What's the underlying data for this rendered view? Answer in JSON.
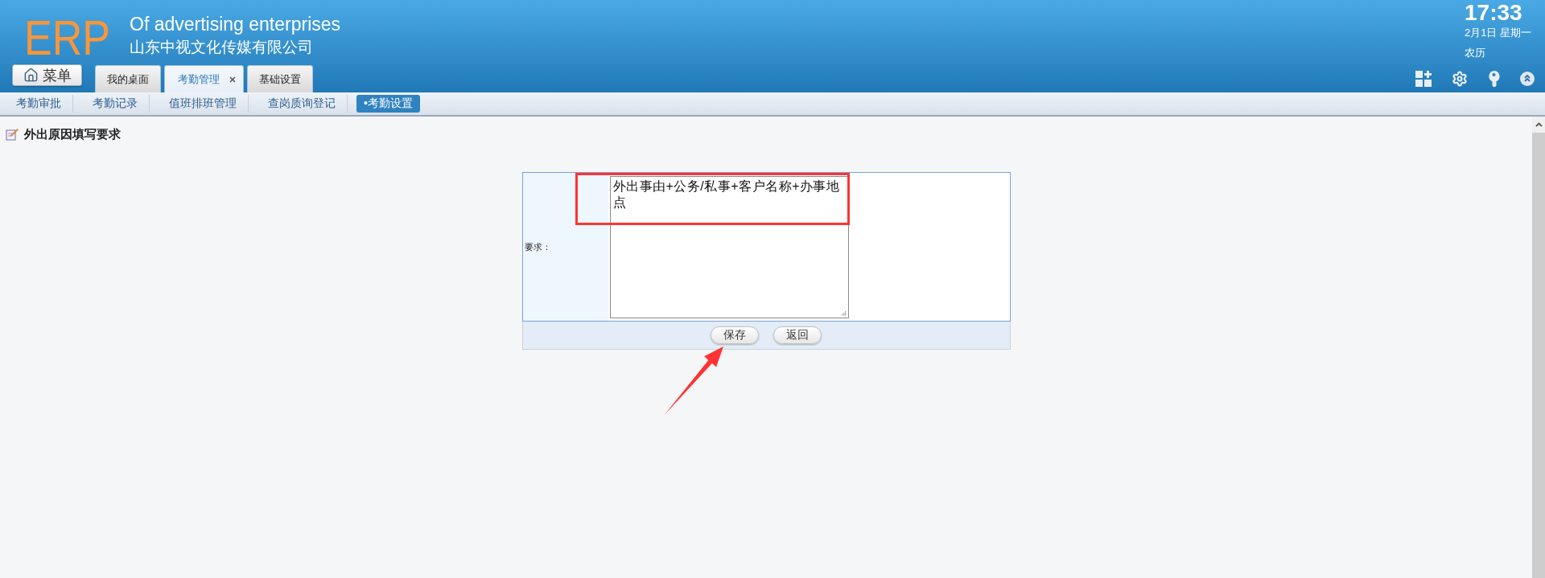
{
  "header": {
    "logo": "ERP",
    "tagline": "Of advertising enterprises",
    "company": "山东中视文化传媒有限公司",
    "clock": {
      "time": "17:33",
      "date": "2月1日 星期一",
      "lunar": "农历"
    }
  },
  "menu_button": {
    "label": "菜单"
  },
  "tabs": [
    {
      "label": "我的桌面",
      "selected": false,
      "closable": false
    },
    {
      "label": "考勤管理",
      "selected": true,
      "closable": true
    },
    {
      "label": "基础设置",
      "selected": false,
      "closable": false
    }
  ],
  "subnav": [
    {
      "label": "考勤审批",
      "selected": false
    },
    {
      "label": "考勤记录",
      "selected": false
    },
    {
      "label": "值班排班管理",
      "selected": false
    },
    {
      "label": "查岗质询登记",
      "selected": false
    },
    {
      "label": "•考勤设置",
      "selected": true
    }
  ],
  "page_title": "外出原因填写要求",
  "form": {
    "field_label": "要求：",
    "value": "外出事由+公务/私事+客户名称+办事地点",
    "highlighted": true,
    "buttons": [
      {
        "label": "保存",
        "arrow": true
      },
      {
        "label": "返回",
        "arrow": false
      }
    ]
  }
}
